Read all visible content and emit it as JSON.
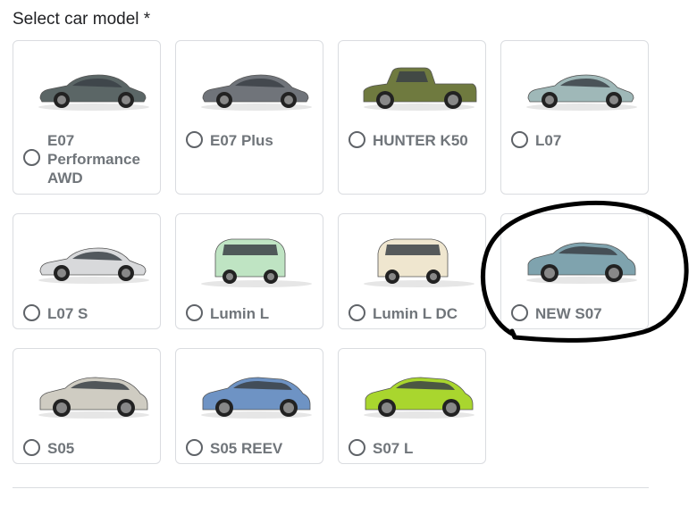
{
  "form": {
    "label": "Select car model *"
  },
  "options": [
    {
      "label": "E07 Performance AWD",
      "color": "#5b6666",
      "style": "sedan",
      "selected": false
    },
    {
      "label": "E07 Plus",
      "color": "#70747a",
      "style": "sedan",
      "selected": false
    },
    {
      "label": "HUNTER K50",
      "color": "#6f7a3f",
      "style": "pickup",
      "selected": false
    },
    {
      "label": "L07",
      "color": "#9fb8b8",
      "style": "sedan",
      "selected": false
    },
    {
      "label": "L07 S",
      "color": "#d8d9db",
      "style": "sedan",
      "selected": false
    },
    {
      "label": "Lumin L",
      "color": "#bfe4c3",
      "style": "mini",
      "selected": false
    },
    {
      "label": "Lumin L DC",
      "color": "#efe6cf",
      "style": "mini",
      "selected": false
    },
    {
      "label": "NEW S07",
      "color": "#7fa3ae",
      "style": "suv",
      "selected": false
    },
    {
      "label": "S05",
      "color": "#cfccc2",
      "style": "suv",
      "selected": false
    },
    {
      "label": "S05 REEV",
      "color": "#6e93c4",
      "style": "suv",
      "selected": false
    },
    {
      "label": "S07 L",
      "color": "#a9d62e",
      "style": "suv",
      "selected": false
    }
  ],
  "annotation": {
    "color": "#000000",
    "circled_option": "NEW S07"
  }
}
